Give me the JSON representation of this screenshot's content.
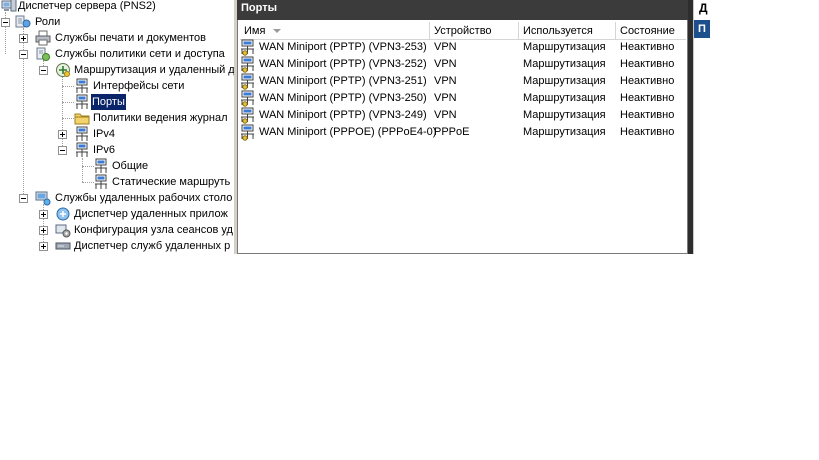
{
  "tree": {
    "root": "Диспетчер сервера (PNS2)",
    "roles": "Роли",
    "print_services": "Службы печати и документов",
    "npas": "Службы политики сети и доступа",
    "rras": "Маршрутизация и удаленный д",
    "net_interfaces": "Интерфейсы сети",
    "ports": "Порты",
    "logging_policy": "Политики ведения журнал",
    "ipv4": "IPv4",
    "ipv6": "IPv6",
    "general": "Общие",
    "static_routes": "Статические маршруть",
    "rds": "Службы удаленных рабочих столо",
    "remoteapp": "Диспетчер удаленных прилож",
    "session_host_config": "Конфигурация узла сеансов уд",
    "rd_services_manager": "Диспетчер служб удаленных р"
  },
  "center": {
    "title": "Порты",
    "columns": {
      "name": "Имя",
      "device": "Устройство",
      "used_by": "Используется",
      "status": "Состояние"
    },
    "rows": [
      {
        "name": "WAN Miniport (PPTP) (VPN3-253)",
        "device": "VPN",
        "used_by": "Маршрутизация",
        "status": "Неактивно"
      },
      {
        "name": "WAN Miniport (PPTP) (VPN3-252)",
        "device": "VPN",
        "used_by": "Маршрутизация",
        "status": "Неактивно"
      },
      {
        "name": "WAN Miniport (PPTP) (VPN3-251)",
        "device": "VPN",
        "used_by": "Маршрутизация",
        "status": "Неактивно"
      },
      {
        "name": "WAN Miniport (PPTP) (VPN3-250)",
        "device": "VPN",
        "used_by": "Маршрутизация",
        "status": "Неактивно"
      },
      {
        "name": "WAN Miniport (PPTP) (VPN3-249)",
        "device": "VPN",
        "used_by": "Маршрутизация",
        "status": "Неактивно"
      },
      {
        "name": "WAN Miniport (PPPOE) (PPPoE4-0)",
        "device": "PPPoE",
        "used_by": "Маршрутизация",
        "status": "Неактивно"
      }
    ]
  },
  "right": {
    "title": "Д",
    "tab": "П"
  },
  "icons": {
    "computer": "server-manager-icon",
    "roles": "roles-icon",
    "printer": "printer-icon",
    "network_policy": "network-policy-icon",
    "routing": "routing-icon",
    "port": "network-port-icon",
    "folder": "folder-icon"
  }
}
